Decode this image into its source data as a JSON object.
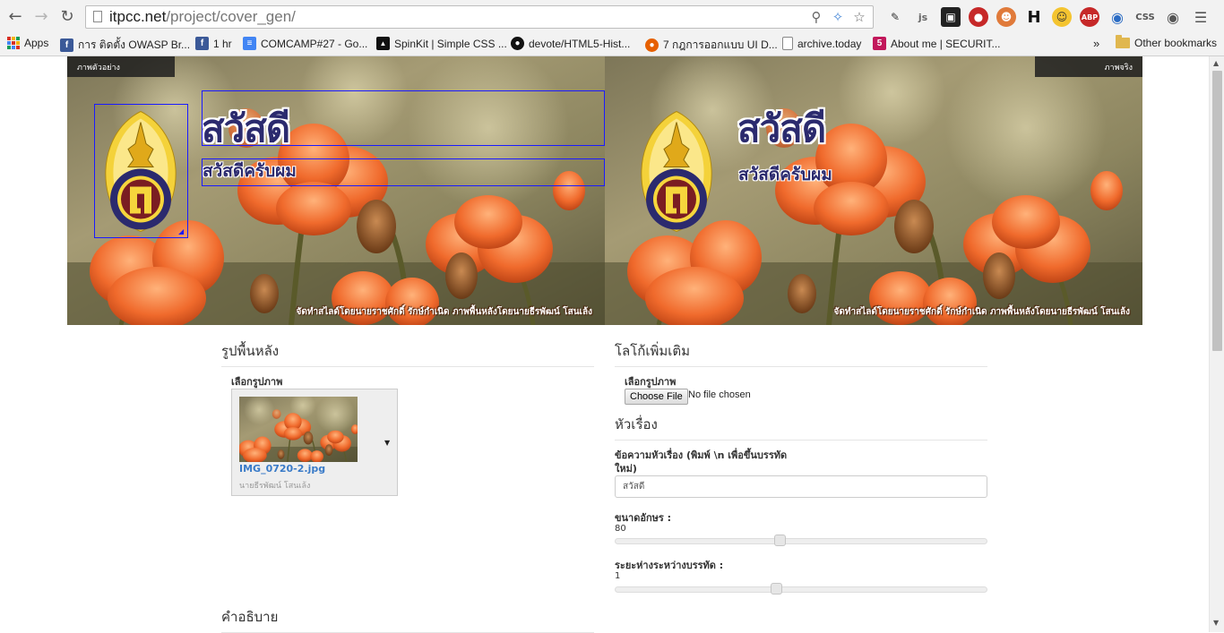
{
  "browser": {
    "url_host": "itpcc.net",
    "url_path": "/project/cover_gen/",
    "extensions": [
      "pen-icon",
      "js-icon",
      "window-icon",
      "stop-icon",
      "santa-icon",
      "H",
      "smiley-icon",
      "ABP",
      "globe-icon",
      "CSS",
      "chat-icon"
    ],
    "bookmarks": [
      {
        "label": "Apps",
        "icon": "apps-grid-icon"
      },
      {
        "label": "การ ติดตั้ง OWASP Br...",
        "icon": "facebook-icon"
      },
      {
        "label": "1 hr",
        "icon": "facebook-icon"
      },
      {
        "label": "COMCAMP#27 - Go...",
        "icon": "docs-icon"
      },
      {
        "label": "SpinKit | Simple CSS ...",
        "icon": "spinkit-icon"
      },
      {
        "label": "devote/HTML5-Hist...",
        "icon": "github-icon"
      },
      {
        "label": "7 กฎการออกแบบ UI D...",
        "icon": "firefox-icon"
      },
      {
        "label": "archive.today",
        "icon": "page-icon"
      },
      {
        "label": "About me | SECURIT...",
        "icon": "site-icon"
      }
    ],
    "overflow": "»",
    "other_bookmarks": "Other bookmarks"
  },
  "preview": {
    "left_label": "ภาพตัวอย่าง",
    "right_label": "ภาพจริง",
    "title": "สวัสดี",
    "subtitle": "สวัสดีครับผม",
    "credit": "จัดทำสไลด์โดยนายราชศักดิ์ รักษ์กำเนิด ภาพพื้นหลังโดยนายธีรพัฒน์ โสนเล้ง"
  },
  "background_section": {
    "heading": "รูปพื้นหลัง",
    "select_label": "เลือกรูปภาพ",
    "file_name": "IMG_0720-2.jpg",
    "author": "นายธีรพัฒน์ โสนเล้ง"
  },
  "logo_section": {
    "heading": "โลโก้เพิ่มเติม",
    "select_label": "เลือกรูปภาพ",
    "choose_button": "Choose File",
    "file_status": "No file chosen"
  },
  "title_section": {
    "heading": "หัวเรื่อง",
    "text_label_line1": "ข้อความหัวเรื่อง (พิมพ์ \\n เพื่อขึ้นบรรทัด",
    "text_label_line2": "ใหม่)",
    "text_value": "สวัสดี",
    "size_label": "ขนาดอักษร :",
    "size_value": "80",
    "size_fraction": 0.44,
    "spacing_label": "ระยะห่างระหว่างบรรทัด :",
    "spacing_value": "1",
    "spacing_fraction": 0.43
  },
  "description_section": {
    "heading": "คำอธิบาย"
  },
  "colors": {
    "title_text": "#2b2a6e",
    "selection_box": "#1a1aff",
    "link": "#3a7bc8"
  }
}
